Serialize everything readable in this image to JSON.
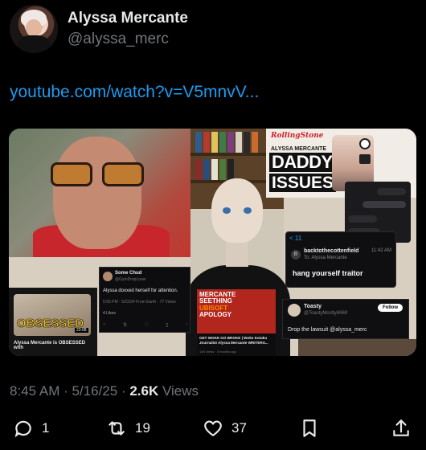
{
  "author": {
    "display_name": "Alyssa Mercante",
    "handle": "@alyssa_merc"
  },
  "post": {
    "link_text": "youtube.com/watch?v=V5mnvV..."
  },
  "media": {
    "rolling_stone": {
      "logo": "RollingStone",
      "name": "ALYSSA MERCANTE",
      "headline_1": "DADDY",
      "headline_2": "ISSUES"
    },
    "dm": {
      "back": "< 11",
      "from": "backtothecottenfield",
      "to": "To: Alyssa Mercante",
      "time": "11:42 AM",
      "message": "hang yourself traitor"
    },
    "gossip": {
      "name": "Some Chud",
      "handle": "@GymDropLoser",
      "text": "Alyssa doxxed herself for attention.",
      "meta": "5:05 PM · 5/22/24 From Earth · 77 Views",
      "likes": "4 Likes"
    },
    "obsessed": {
      "word": "OBSESSED",
      "duration": "23:08",
      "caption": "Alyssa Mercante is OBSESSED with"
    },
    "youtube": {
      "title_1": "MERCANTE",
      "title_2": "SEETHING",
      "title_3": "UBISOFT",
      "title_4": "APOLOGY",
      "caption": "GET WOKE GO BROKE | Woke Kotaku Journalist Alyssa Mercante WRITERS...",
      "views": "13K views · 3 months ago"
    },
    "toasty": {
      "name": "Toasty",
      "handle": "@ToastyMostly6969",
      "follow": "Follow",
      "text": "Drop the lawsuit @alyssa_merc"
    }
  },
  "meta": {
    "time": "8:45 AM",
    "separator": " · ",
    "date": "5/16/25",
    "views_count": "2.6K",
    "views_label": " Views"
  },
  "actions": {
    "reply_count": "1",
    "repost_count": "19",
    "like_count": "37",
    "icons": [
      "reply-icon",
      "repost-icon",
      "like-icon",
      "bookmark-icon",
      "share-icon"
    ]
  },
  "colors": {
    "background": "#000000",
    "link": "#1d9bf0",
    "muted": "#71767b",
    "text": "#e7e9ea"
  }
}
